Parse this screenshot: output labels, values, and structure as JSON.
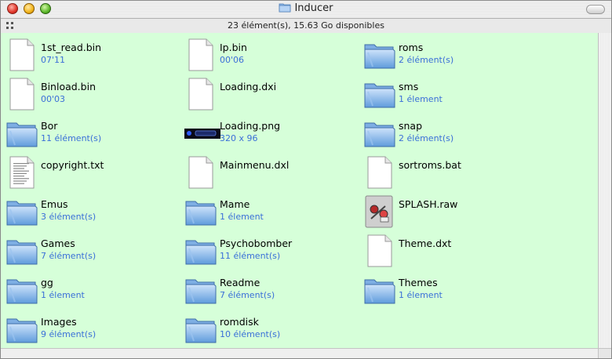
{
  "window": {
    "title": "Inducer",
    "status": "23 élément(s), 15.63 Go disponibles"
  },
  "columns": [
    [
      {
        "name": "1st_read.bin",
        "info": "07'11",
        "type": "document"
      },
      {
        "name": "Binload.bin",
        "info": "00'03",
        "type": "document"
      },
      {
        "name": "Bor",
        "info": "11 élément(s)",
        "type": "folder"
      },
      {
        "name": "copyright.txt",
        "info": "",
        "type": "text"
      },
      {
        "name": "Emus",
        "info": "3 élément(s)",
        "type": "folder"
      },
      {
        "name": "Games",
        "info": "7 élément(s)",
        "type": "folder"
      },
      {
        "name": "gg",
        "info": "1 élement",
        "type": "folder"
      },
      {
        "name": "Images",
        "info": "9 élément(s)",
        "type": "folder"
      }
    ],
    [
      {
        "name": "Ip.bin",
        "info": "00'06",
        "type": "document"
      },
      {
        "name": "Loading.dxi",
        "info": "",
        "type": "document"
      },
      {
        "name": "Loading.png",
        "info": "320 x 96",
        "type": "image"
      },
      {
        "name": "Mainmenu.dxl",
        "info": "",
        "type": "document"
      },
      {
        "name": "Mame",
        "info": "1 élement",
        "type": "folder"
      },
      {
        "name": "Psychobomber",
        "info": "11 élément(s)",
        "type": "folder"
      },
      {
        "name": "Readme",
        "info": "7 élément(s)",
        "type": "folder"
      },
      {
        "name": "romdisk",
        "info": "10 élément(s)",
        "type": "folder"
      }
    ],
    [
      {
        "name": "roms",
        "info": "2 élément(s)",
        "type": "folder"
      },
      {
        "name": "sms",
        "info": "1 élement",
        "type": "folder"
      },
      {
        "name": "snap",
        "info": "2 élément(s)",
        "type": "folder"
      },
      {
        "name": "sortroms.bat",
        "info": "",
        "type": "document"
      },
      {
        "name": "SPLASH.raw",
        "info": "",
        "type": "raw"
      },
      {
        "name": "Theme.dxt",
        "info": "",
        "type": "document"
      },
      {
        "name": "Themes",
        "info": "1 élement",
        "type": "folder"
      }
    ]
  ],
  "icons": {
    "document": "document-icon",
    "folder": "folder-icon",
    "text": "text-file-icon",
    "image": "image-thumbnail-icon",
    "raw": "raw-image-icon"
  },
  "colors": {
    "background": "#d6ffd9",
    "info_text": "#3a6fd8"
  }
}
